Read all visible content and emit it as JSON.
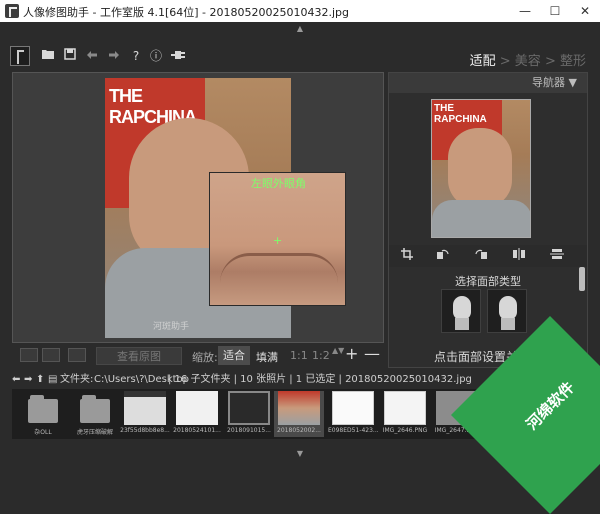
{
  "window": {
    "title": "人像修图助手 - 工作室版 4.1[64位] - 20180520025010432.jpg",
    "minimize": "—",
    "maximize": "☐",
    "close": "✕"
  },
  "toolbar": {
    "icons": [
      "logo-icon",
      "folder-icon",
      "save-icon",
      "undo-icon",
      "redo-icon",
      "help-icon",
      "info-icon",
      "plugin-icon"
    ],
    "help": "?",
    "info": "ⓘ"
  },
  "modes": {
    "active": "适配",
    "sep1": ">",
    "beauty": "美容",
    "sep2": ">",
    "reshape": "整形"
  },
  "canvas": {
    "poster_text": "THE RAPCHINA",
    "zoom_label": "左眼外眼角",
    "crosshair": "+",
    "watermark": "河斑助手"
  },
  "view_bar": {
    "see_original": "查看原图",
    "zoom_label": "缩放:",
    "fit": "适合",
    "fill": "填满",
    "z1": "1:1",
    "z2": "1:2",
    "updown": "▲▼",
    "plus": "+",
    "minus": "—"
  },
  "navigator": {
    "title": "导航器 ▼",
    "thumb_text": "THE RAPCHINA"
  },
  "face_panel": {
    "select_face_type": "选择面部类型",
    "set_keypoints": "点击面部设置关键点"
  },
  "path_bar": {
    "label": "文件夹:",
    "path": "C:\\Users\\?\\Desktop",
    "summary": "| 16 子文件夹 | 10 张照片 | 1 已选定 | 20180520025010432.jpg"
  },
  "filmstrip": [
    {
      "caption": "杂OLL",
      "type": "folder"
    },
    {
      "caption": "虎牙压缩破解",
      "type": "folder"
    },
    {
      "caption": "23f55d8bb8e8...",
      "type": "image"
    },
    {
      "caption": "20180524101...",
      "type": "image"
    },
    {
      "caption": "2018091015...",
      "type": "image"
    },
    {
      "caption": "2018052002...",
      "type": "image",
      "selected": true
    },
    {
      "caption": "E098ED51-423...",
      "type": "image"
    },
    {
      "caption": "IMG_2646.PNG",
      "type": "image"
    },
    {
      "caption": "IMG_2647.PNG",
      "type": "image"
    },
    {
      "caption": "",
      "type": "image"
    }
  ],
  "ad": {
    "text": "河绵软件"
  }
}
